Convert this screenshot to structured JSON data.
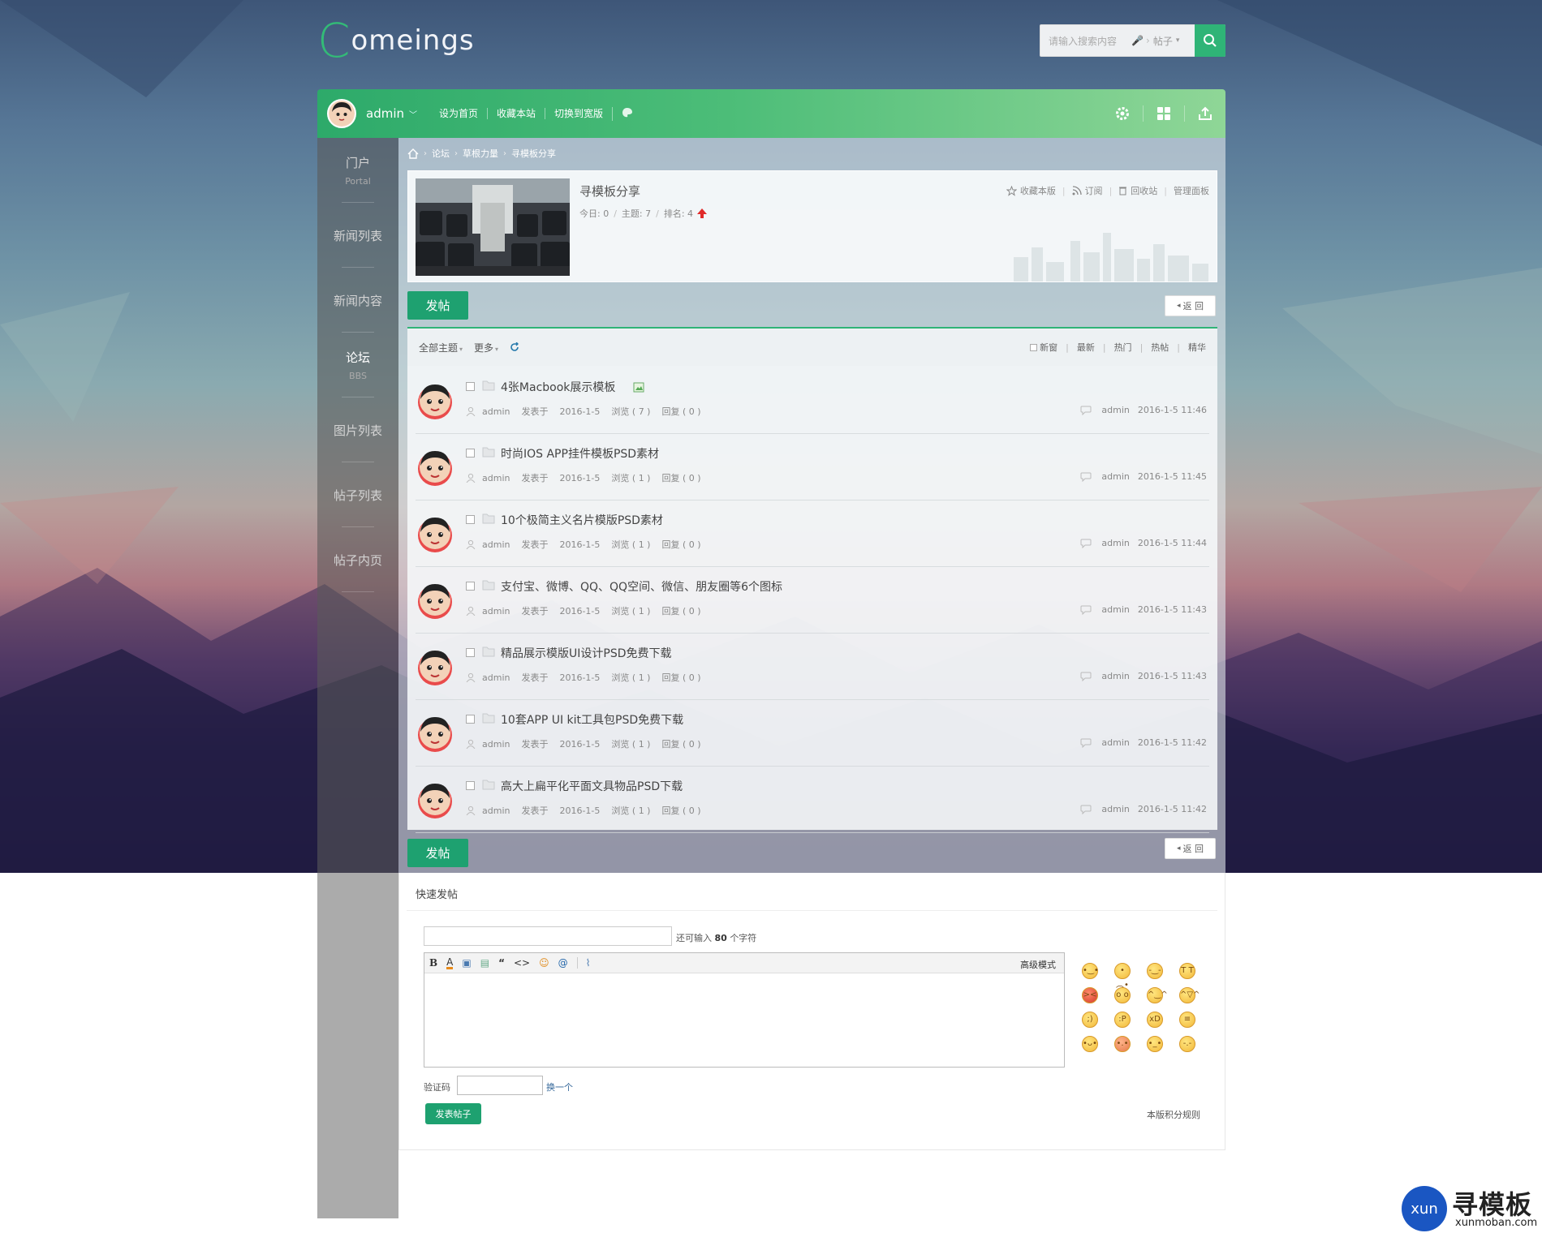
{
  "brand": {
    "logo_c": "C",
    "logo_rest": "omeings",
    "accent": "#2fb477"
  },
  "search": {
    "placeholder": "请输入搜索内容",
    "type": "帖子"
  },
  "topbar": {
    "user": "admin",
    "links": [
      "设为首页",
      "收藏本站",
      "切换到宽版"
    ],
    "icons": [
      "gear-icon",
      "grid-icon",
      "share-icon"
    ]
  },
  "sidebar": {
    "items": [
      {
        "zh": "门户",
        "en": "Portal"
      },
      {
        "zh": "新闻列表",
        "en": ""
      },
      {
        "zh": "新闻内容",
        "en": ""
      },
      {
        "zh": "论坛",
        "en": "BBS"
      },
      {
        "zh": "图片列表",
        "en": ""
      },
      {
        "zh": "帖子列表",
        "en": ""
      },
      {
        "zh": "帖子内页",
        "en": ""
      }
    ]
  },
  "breadcrumb": [
    "论坛",
    "草根力量",
    "寻模板分享"
  ],
  "forum": {
    "title": "寻模板分享",
    "today": "今日: 0",
    "topics": "主题: 7",
    "rank": "排名: 4",
    "actions": [
      "收藏本版",
      "订阅",
      "回收站",
      "管理面板"
    ]
  },
  "buttons": {
    "post": "发帖",
    "back": "返 回"
  },
  "list_head": {
    "all": "全部主题",
    "more": "更多",
    "new_window": "新窗",
    "filters": [
      "最新",
      "热门",
      "热帖",
      "精华"
    ]
  },
  "threads": [
    {
      "title": "4张Macbook展示模板",
      "author": "admin",
      "posted": "发表于",
      "date": "2016-1-5",
      "views": "浏览 ( 7 )",
      "replies": "回复 ( 0 )",
      "last_user": "admin",
      "last_time": "2016-1-5 11:46"
    },
    {
      "title": "时尚IOS APP挂件模板PSD素材",
      "author": "admin",
      "posted": "发表于",
      "date": "2016-1-5",
      "views": "浏览 ( 1 )",
      "replies": "回复 ( 0 )",
      "last_user": "admin",
      "last_time": "2016-1-5 11:45"
    },
    {
      "title": "10个极简主义名片模版PSD素材",
      "author": "admin",
      "posted": "发表于",
      "date": "2016-1-5",
      "views": "浏览 ( 1 )",
      "replies": "回复 ( 0 )",
      "last_user": "admin",
      "last_time": "2016-1-5 11:44"
    },
    {
      "title": "支付宝、微博、QQ、QQ空间、微信、朋友圈等6个图标",
      "author": "admin",
      "posted": "发表于",
      "date": "2016-1-5",
      "views": "浏览 ( 1 )",
      "replies": "回复 ( 0 )",
      "last_user": "admin",
      "last_time": "2016-1-5 11:43"
    },
    {
      "title": "精品展示模版UI设计PSD免费下载",
      "author": "admin",
      "posted": "发表于",
      "date": "2016-1-5",
      "views": "浏览 ( 1 )",
      "replies": "回复 ( 0 )",
      "last_user": "admin",
      "last_time": "2016-1-5 11:43"
    },
    {
      "title": "10套APP UI kit工具包PSD免费下载",
      "author": "admin",
      "posted": "发表于",
      "date": "2016-1-5",
      "views": "浏览 ( 1 )",
      "replies": "回复 ( 0 )",
      "last_user": "admin",
      "last_time": "2016-1-5 11:42"
    },
    {
      "title": "高大上扁平化平面文具物品PSD下载",
      "author": "admin",
      "posted": "发表于",
      "date": "2016-1-5",
      "views": "浏览 ( 1 )",
      "replies": "回复 ( 0 )",
      "last_user": "admin",
      "last_time": "2016-1-5 11:42"
    }
  ],
  "quick": {
    "title": "快速发帖",
    "remain_pre": "还可输入",
    "remain_num": "80",
    "remain_post": "个字符",
    "advanced": "高级模式",
    "toolbar": [
      "B",
      "A",
      "▣",
      "▤",
      "“",
      "<>",
      "☺",
      "@",
      "⌇"
    ],
    "captcha_label": "验证码",
    "captcha_change": "换一个",
    "submit": "发表帖子",
    "rules": "本版积分规则"
  },
  "watermark": {
    "ball": "xun",
    "name": "寻模板",
    "url": "xunmoban.com"
  }
}
